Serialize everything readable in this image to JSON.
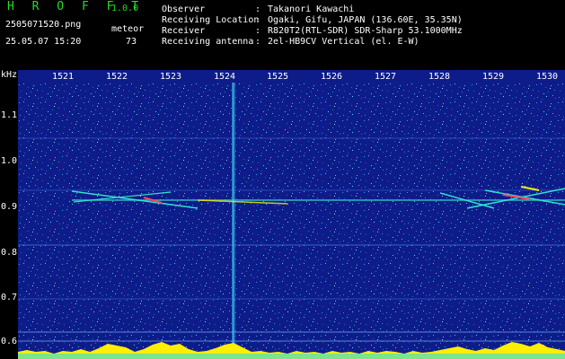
{
  "header": {
    "app_name": "H R O F F T",
    "app_version": "1.0.0",
    "file_name": "2505071520.png",
    "datetime": "25.05.07 15:20",
    "meteor_label": "meteor",
    "meteor_count": "73",
    "info": [
      {
        "key": "Observer",
        "value": "Takanori Kawachi"
      },
      {
        "key": "Receiving Location",
        "value": "Ogaki, Gifu, JAPAN (136.60E, 35.35N)"
      },
      {
        "key": "Receiver",
        "value": "R820T2(RTL-SDR) SDR-Sharp 53.1000MHz"
      },
      {
        "key": "Receiving antenna",
        "value": "2el-HB9CV Vertical (el. E-W)"
      }
    ]
  },
  "axes": {
    "y_unit": "kHz",
    "y_ticks": [
      "1.1",
      "1.0",
      "0.9",
      "0.8",
      "0.7",
      "0.6"
    ],
    "x_ticks": [
      "1521",
      "1522",
      "1523",
      "1524",
      "1525",
      "1526",
      "1527",
      "1528",
      "1529",
      "1530"
    ]
  },
  "colors": {
    "background": "#000000",
    "plot_bg": "#0e1c8a",
    "title_green": "#22dd22",
    "signal_cyan": "#33e0d0",
    "signal_yellow": "#ffee00",
    "signal_red": "#ff4060"
  }
}
